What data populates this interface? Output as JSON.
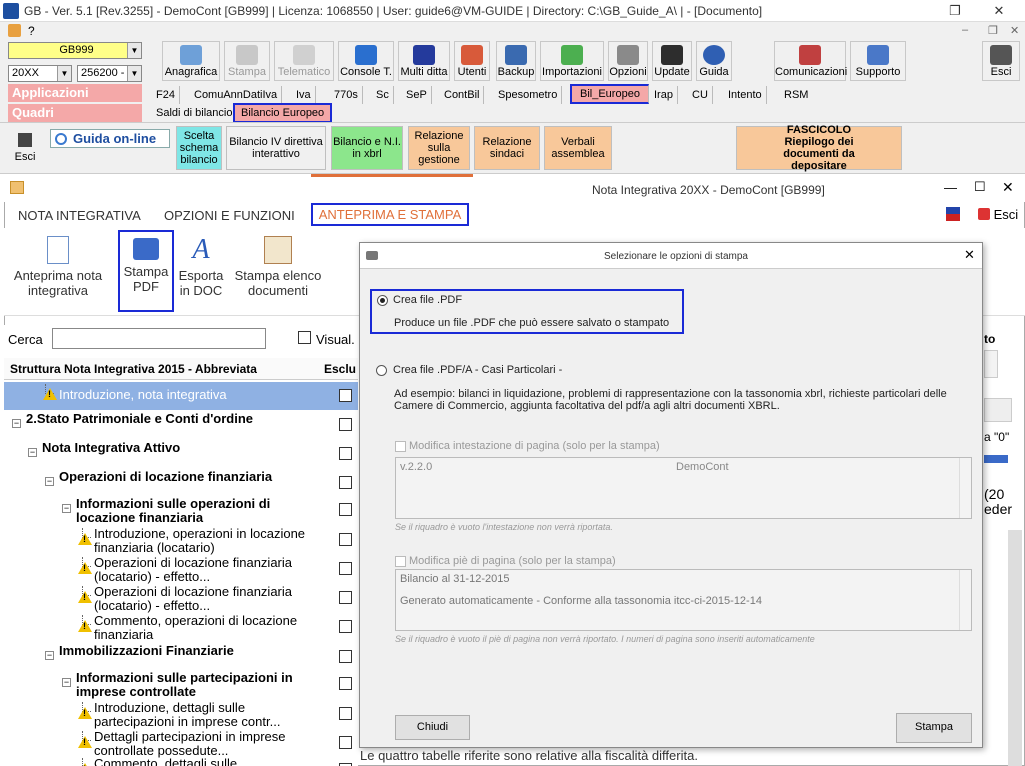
{
  "window": {
    "title": "GB - Ver. 5.1 [Rev.3255] -  DemoCont [GB999]    | Licenza: 1068550 | User: guide6@VM-GUIDE | Directory: C:\\GB_Guide_A\\ | - [Documento]",
    "help_mark": "?"
  },
  "selectors": {
    "company": "GB999",
    "year": "20XX",
    "account": "256200 -"
  },
  "pinkbars": {
    "applicazioni": "Applicazioni",
    "quadri": "Quadri"
  },
  "toolbar": [
    {
      "label": "Anagrafica"
    },
    {
      "label": "Stampa"
    },
    {
      "label": "Telematico"
    },
    {
      "label": "Console T."
    },
    {
      "label": "Multi ditta"
    },
    {
      "label": "Utenti"
    },
    {
      "label": "Backup"
    },
    {
      "label": "Importazioni"
    },
    {
      "label": "Opzioni"
    },
    {
      "label": "Update"
    },
    {
      "label": "Guida"
    },
    {
      "label": "Comunicazioni"
    },
    {
      "label": "Supporto"
    },
    {
      "label": "Esci"
    }
  ],
  "app_tabs": [
    "F24",
    "ComuAnnDatiIva",
    "Iva",
    "770s",
    "Sc",
    "SeP",
    "ContBil",
    "Spesometro",
    "Bil_Europeo",
    "Irap",
    "CU",
    "Intento",
    "RSM"
  ],
  "quadri_tabs": [
    "Saldi di bilancio",
    "Bilancio Europeo"
  ],
  "ribbon": {
    "esci": "Esci",
    "guida": "Guida on-line",
    "scelta": "Scelta schema bilancio",
    "bilancio_iv": "Bilancio IV direttiva interattivo",
    "bilancio_xbrl": "Bilancio e N.I. in xbrl",
    "relazione_gestione": "Relazione sulla gestione",
    "relazione_sindaci": "Relazione sindaci",
    "verbali": "Verbali assemblea",
    "fascicolo_title": "FASCICOLO",
    "fascicolo_sub": "Riepilogo dei documenti da depositare"
  },
  "subwindow": {
    "title": "Nota Integrativa 20XX - DemoCont [GB999]",
    "tabs": [
      "NOTA INTEGRATIVA",
      "OPZIONI E FUNZIONI",
      "ANTEPRIMA E STAMPA"
    ],
    "esci": "Esci",
    "tools": [
      {
        "label": "Anteprima nota integrativa"
      },
      {
        "label": "Stampa PDF"
      },
      {
        "label": "Esporta in DOC"
      },
      {
        "label": "Stampa elenco documenti"
      }
    ],
    "search_label": "Cerca",
    "visual_label": "Visual.",
    "tree_header": "Struttura Nota Integrativa 2015 - Abbreviata",
    "tree_header2": "Esclu",
    "tree": [
      {
        "text": "Introduzione, nota integrativa",
        "level": 2,
        "warn": true,
        "selected": true
      },
      {
        "text": "2.Stato Patrimoniale e Conti d'ordine",
        "level": 0,
        "bold": true
      },
      {
        "text": "Nota Integrativa Attivo",
        "level": 1,
        "bold": true
      },
      {
        "text": "Operazioni di locazione finanziaria",
        "level": 2,
        "bold": true
      },
      {
        "text": "Informazioni sulle operazioni di locazione finanziaria",
        "level": 3,
        "bold": true
      },
      {
        "text": "Introduzione, operazioni in locazione finanziaria (locatario)",
        "level": 4,
        "warn": true
      },
      {
        "text": "Operazioni di locazione finanziaria (locatario) - effetto...",
        "level": 4,
        "warn": true
      },
      {
        "text": "Operazioni di locazione finanziaria (locatario) - effetto...",
        "level": 4,
        "warn": true
      },
      {
        "text": "Commento, operazioni di locazione finanziaria",
        "level": 4,
        "warn": true
      },
      {
        "text": "Immobilizzazioni Finanziarie",
        "level": 2,
        "bold": true
      },
      {
        "text": "Informazioni sulle partecipazioni in imprese controllate",
        "level": 3,
        "bold": true
      },
      {
        "text": "Introduzione, dettagli sulle partecipazioni in imprese contr...",
        "level": 4,
        "warn": true
      },
      {
        "text": "Dettagli partecipazioni in imprese controllate possedute...",
        "level": 4,
        "warn": true
      },
      {
        "text": "Commento, dettagli sulle",
        "level": 4,
        "warn": true
      }
    ],
    "right_fragments": {
      "a": "to",
      "b": "a \"0\"",
      "c": "(20",
      "d": "eder"
    },
    "bottom_text": "Le quattro tabelle riferite sono relative alla fiscalità differita."
  },
  "dialog": {
    "title": "Selezionare le opzioni di stampa",
    "opt1_label": "Crea file .PDF",
    "opt1_desc": "Produce un file .PDF che può essere salvato o stampato",
    "opt2_label": "Crea file .PDF/A  - Casi Particolari -",
    "opt2_desc1": "Ad esempio: bilanci in liquidazione, problemi di rappresentazione con la tassonomia xbrl, richieste particolari delle",
    "opt2_desc2": "Camere di Commercio, aggiunta facoltativa del pdf/a agli altri documenti XBRL.",
    "header_chk": "Modifica intestazione di pagina (solo per la stampa)",
    "header_left": "v.2.2.0",
    "header_center": "DemoCont",
    "header_note": "Se il riquadro è vuoto l'intestazione non verrà riportata.",
    "footer_chk": "Modifica piè di pagina (solo per la stampa)",
    "footer_line1": "Bilancio al 31-12-2015",
    "footer_line2": "Generato automaticamente - Conforme alla tassonomia itcc-ci-2015-12-14",
    "footer_note": "Se il riquadro è vuoto il piè di pagina non verrà riportato. I numeri di pagina sono inseriti automaticamente",
    "chiudi": "Chiudi",
    "stampa": "Stampa"
  },
  "colors": {
    "highlight": "#1a2ad6",
    "pink": "#f4a8a8",
    "ribbon_cyan": "#7fe6e6",
    "ribbon_green": "#8ce68c",
    "ribbon_orange": "#f8c89a",
    "accent_orange": "#e0703a"
  }
}
